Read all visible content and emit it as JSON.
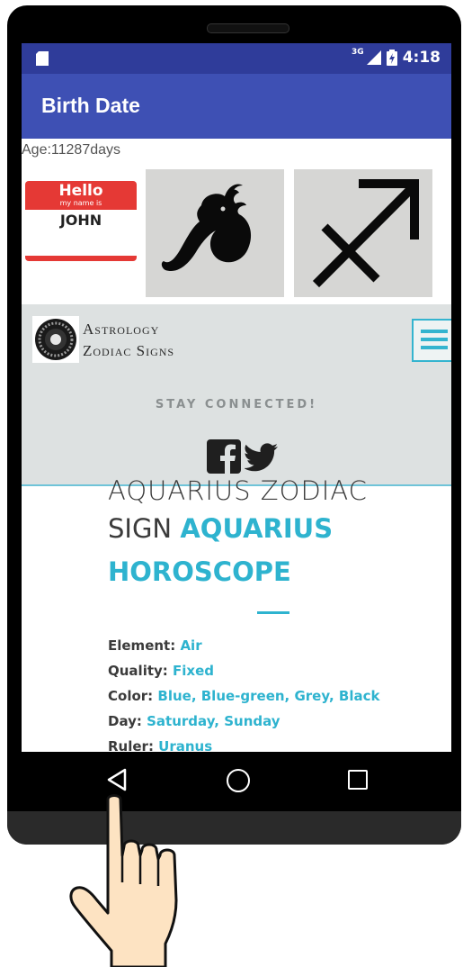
{
  "status_bar": {
    "network_label": "3G",
    "time": "4:18",
    "icons": [
      "sd-card-icon",
      "signal-icon",
      "battery-icon"
    ]
  },
  "toolbar": {
    "title": "Birth Date"
  },
  "age": {
    "text": "Age:11287days"
  },
  "tiles": {
    "hello": {
      "greeting": "Hello",
      "subtitle": "my name is",
      "name": "JOHN"
    },
    "taurus": {
      "icon": "taurus-sign-icon"
    },
    "sagittarius": {
      "icon": "sagittarius-sign-icon"
    }
  },
  "web": {
    "logo_line1": "Astrology",
    "logo_line2": "Zodiac Signs",
    "stay_connected": "STAY CONNECTED!",
    "social_icons": [
      "facebook-icon",
      "twitter-icon"
    ]
  },
  "article": {
    "heading_line1": "AQUARIUS ZODIAC",
    "heading_line2_plain": "SIGN ",
    "heading_line2_accent": "AQUARIUS",
    "heading_line3": "HOROSCOPE",
    "facts": [
      {
        "label": "Element: ",
        "value": "Air"
      },
      {
        "label": "Quality: ",
        "value": "Fixed"
      },
      {
        "label": "Color: ",
        "value": "Blue, Blue-green, Grey, Black"
      },
      {
        "label": "Day: ",
        "value": "Saturday, Sunday"
      },
      {
        "label": "Ruler: ",
        "value": "Uranus"
      }
    ]
  },
  "colors": {
    "status_bar": "#2f3c9a",
    "toolbar": "#3e50b4",
    "accent": "#2eb3cf",
    "hello_red": "#e53935"
  },
  "nav": {
    "icons": [
      "back-icon",
      "home-icon",
      "recent-apps-icon"
    ]
  }
}
